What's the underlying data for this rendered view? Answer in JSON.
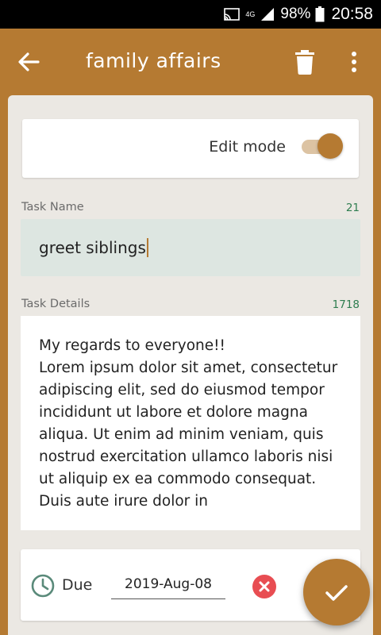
{
  "status_bar": {
    "network_type": "4G",
    "battery": "98%",
    "time": "20:58"
  },
  "app_bar": {
    "title": "family affairs",
    "back_icon": "arrow-left-icon",
    "delete_icon": "trash-icon",
    "menu_icon": "more-vert-icon"
  },
  "edit_mode": {
    "label": "Edit mode",
    "enabled": true
  },
  "task_name": {
    "label": "Task Name",
    "counter": "21",
    "value": "greet siblings"
  },
  "task_details": {
    "label": "Task Details",
    "counter": "1718",
    "value": "My regards to everyone!!\nLorem ipsum dolor sit amet, consectetur adipiscing elit, sed do eiusmod tempor incididunt ut labore et dolore magna aliqua. Ut enim ad minim veniam, quis nostrud exercitation ullamco laboris nisi ut aliquip ex ea commodo consequat. Duis aute irure dolor in"
  },
  "due": {
    "label": "Due",
    "date": "2019-Aug-08",
    "clock_icon": "clock-icon",
    "clear_icon": "clear-icon"
  },
  "fab": {
    "icon": "check-icon"
  },
  "colors": {
    "primary": "#b57a32",
    "counter": "#2e7d4f",
    "clear": "#e84d52",
    "name_field_bg": "#dde6e1"
  }
}
